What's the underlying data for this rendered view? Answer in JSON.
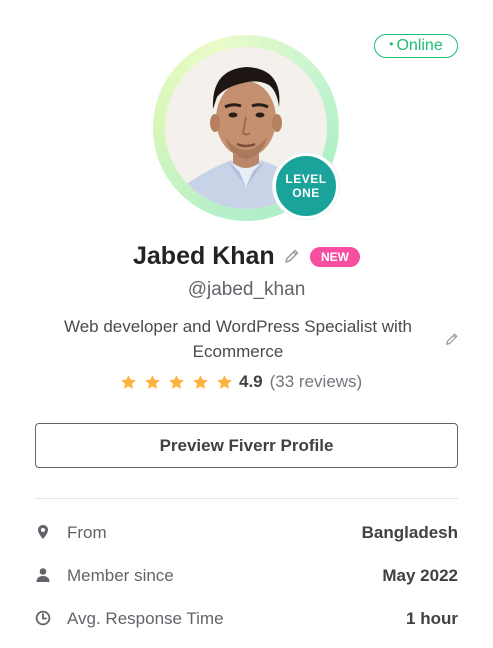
{
  "status": {
    "dot": "•",
    "label": "Online"
  },
  "avatar": {
    "level_line1": "LEVEL",
    "level_line2": "ONE"
  },
  "profile": {
    "name": "Jabed Khan",
    "badge": "NEW",
    "username": "@jabed_khan",
    "tagline": "Web developer and WordPress Specialist with Ecommerce"
  },
  "rating": {
    "stars": 5,
    "value": "4.9",
    "reviews": "(33 reviews)"
  },
  "actions": {
    "preview_label": "Preview Fiverr Profile"
  },
  "stats": [
    {
      "icon": "location-pin-icon",
      "label": "From",
      "value": "Bangladesh"
    },
    {
      "icon": "user-icon",
      "label": "Member since",
      "value": "May 2022"
    },
    {
      "icon": "clock-icon",
      "label": "Avg. Response Time",
      "value": "1 hour"
    }
  ],
  "colors": {
    "online_green": "#1dbf73",
    "level_teal": "#1aa39a",
    "new_pink": "#f74ea1",
    "star_orange": "#ffb33e"
  }
}
